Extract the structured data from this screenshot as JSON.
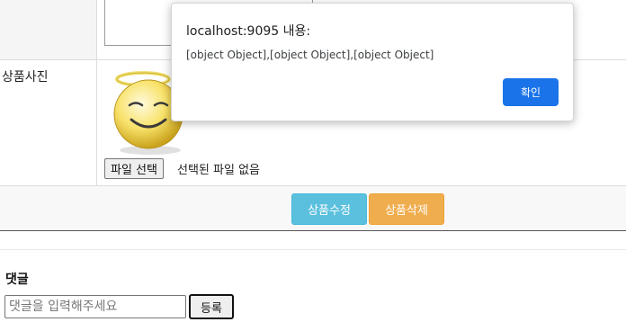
{
  "dialog": {
    "title": "localhost:9095 내용:",
    "message": "[object Object],[object Object],[object Object]",
    "ok_label": "확인",
    "accent_color": "#1a73e8"
  },
  "product": {
    "photo_label": "상품사진",
    "file_button_label": "파일 선택",
    "file_status": "선택된 파일 없음",
    "photo_icon": "angel-smiley-icon"
  },
  "actions": {
    "edit_label": "상품수정",
    "edit_color": "#5bc0de",
    "delete_label": "상품삭제",
    "delete_color": "#f0ad4e"
  },
  "comments": {
    "title": "댓글",
    "input_value": "",
    "input_placeholder": "댓글을 입력해주세요",
    "submit_label": "등록"
  }
}
